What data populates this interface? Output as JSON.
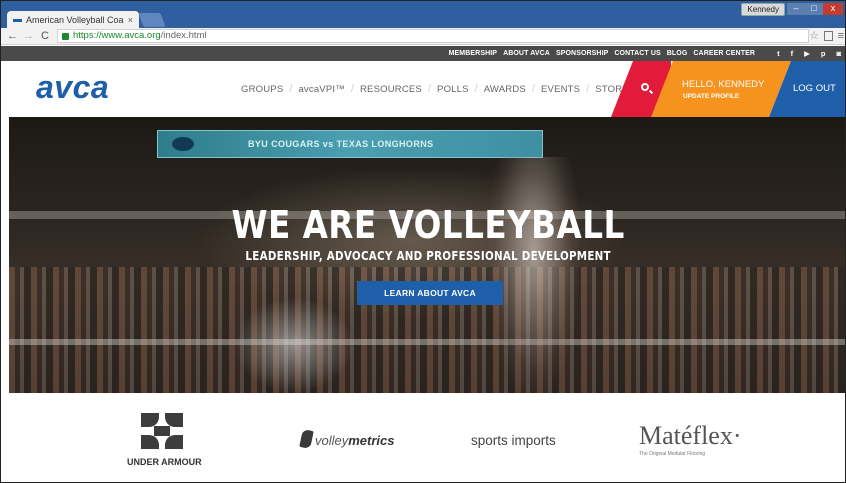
{
  "browser": {
    "tab_title": "American Volleyball Coa",
    "tab_close": "×",
    "profile": "Kennedy",
    "url_secure": "https://www.avca.org",
    "url_path": "/index.html",
    "back": "←",
    "forward": "→",
    "reload": "C",
    "star": "☆",
    "menu": "≡",
    "minimize": "–",
    "maximize": "□",
    "close": "x"
  },
  "utility_nav": {
    "links": [
      "MEMBERSHIP",
      "ABOUT AVCA",
      "SPONSORSHIP",
      "CONTACT US",
      "BLOG",
      "CAREER CENTER"
    ],
    "social_icons": [
      "twitter-icon",
      "facebook-icon",
      "youtube-icon",
      "pinterest-icon",
      "instagram-icon"
    ],
    "social_glyphs": [
      "t",
      "f",
      "▶",
      "p",
      "◙"
    ]
  },
  "header": {
    "logo": "avca",
    "nav": [
      "GROUPS",
      "avcaVPI™",
      "RESOURCES",
      "POLLS",
      "AWARDS",
      "EVENTS",
      "STORE"
    ],
    "separator": "/",
    "greeting": "HELLO, KENNEDY",
    "update_profile": "UPDATE PROFILE",
    "logout": "LOG OUT"
  },
  "hero": {
    "banner_text": "BYU COUGARS vs TEXAS LONGHORNS",
    "title": "WE ARE VOLLEYBALL",
    "subtitle": "LEADERSHIP, ADVOCACY AND PROFESSIONAL DEVELOPMENT",
    "cta": "LEARN ABOUT AVCA"
  },
  "sponsors": {
    "under_armour": "UNDER ARMOUR",
    "volleymetrics_prefix": "volley",
    "volleymetrics_suffix": "metrics",
    "sports_imports": "sports imports",
    "mateflex": "Matéflex·",
    "mateflex_tagline": "The Original Modular Flooring"
  },
  "colors": {
    "brand_blue": "#1f5ea8",
    "search_red": "#e31b3b",
    "greet_orange": "#f6931f",
    "utility_gray": "#4a4a4a"
  }
}
